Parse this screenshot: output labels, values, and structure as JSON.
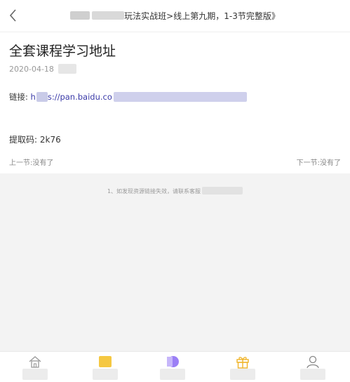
{
  "header": {
    "title": "玩法实战班>线上第九期，1-3节完整版》"
  },
  "article": {
    "title": "全套课程学习地址",
    "date": "2020-04-18",
    "link_label": "链接: ",
    "link_prefix": "h",
    "link_url": "s://pan.baidu.co",
    "code_label": "提取码: ",
    "code_value": "2k76"
  },
  "navigation": {
    "prev": "上一节:没有了",
    "next": "下一节:没有了"
  },
  "notice": {
    "text": "1、如发现资源链接失效，请联系客服"
  },
  "tabbar": {
    "icons": [
      "home-icon",
      "grid-icon",
      "discover-icon",
      "gift-icon",
      "user-icon"
    ],
    "accent_colors": {
      "grid": "#f5c842",
      "discover": "#9b7ff5",
      "gift": "#f0b429"
    }
  }
}
